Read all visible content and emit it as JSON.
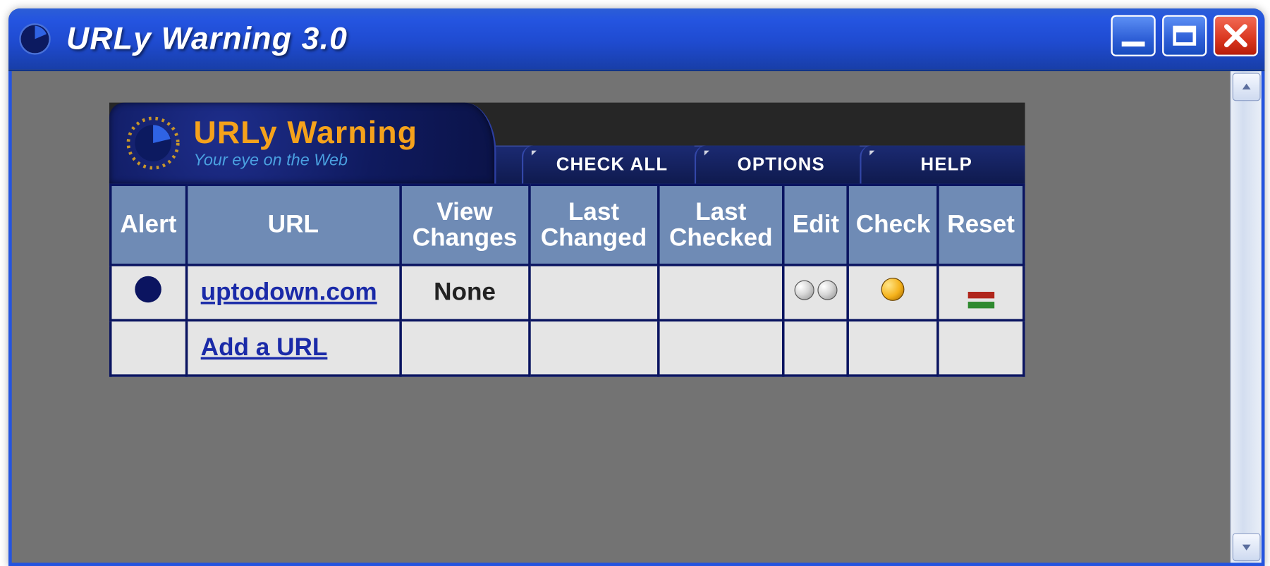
{
  "titlebar": {
    "title": "URLy Warning 3.0"
  },
  "logo": {
    "main": "URLy Warning",
    "sub": "Your eye on the Web"
  },
  "toolbar": {
    "check_all": "CHECK ALL",
    "options": "OPTIONS",
    "help": "HELP"
  },
  "table": {
    "headers": {
      "alert": "Alert",
      "url": "URL",
      "view_changes_l1": "View",
      "view_changes_l2": "Changes",
      "last_changed_l1": "Last",
      "last_changed_l2": "Changed",
      "last_checked_l1": "Last",
      "last_checked_l2": "Checked",
      "edit": "Edit",
      "check": "Check",
      "reset": "Reset"
    },
    "rows": [
      {
        "alert": "on",
        "url": "uptodown.com",
        "view_changes": "None",
        "last_changed": "",
        "last_checked": ""
      }
    ],
    "add_url_label": "Add a URL"
  }
}
